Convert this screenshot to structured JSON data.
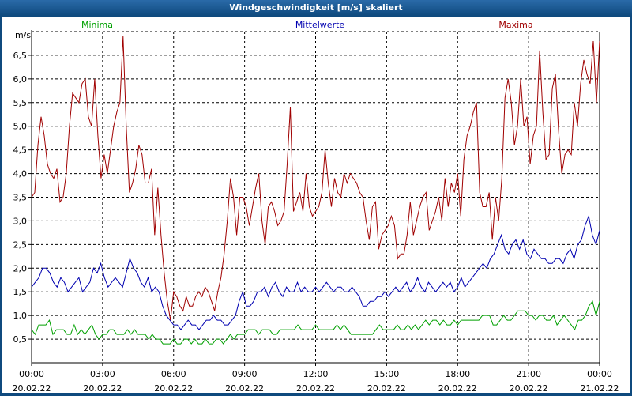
{
  "window": {
    "title": "Windgeschwindigkeit [m/s] skaliert"
  },
  "colors": {
    "minima": "#00a000",
    "mittel": "#0000b0",
    "maxima": "#a00000",
    "titlebar": "#0f4a7e"
  },
  "chart_data": {
    "type": "line",
    "title": "Windgeschwindigkeit [m/s] skaliert",
    "ylabel": "m/s",
    "xlabel": "",
    "ylim": [
      0,
      7.0
    ],
    "xlim": [
      0,
      144
    ],
    "grid": true,
    "legend_position": "top",
    "y_ticks": [
      "0,5",
      "1,0",
      "1,5",
      "2,0",
      "2,5",
      "3,0",
      "3,5",
      "4,0",
      "4,5",
      "5,0",
      "5,5",
      "6,0",
      "6,5"
    ],
    "x_ticks": [
      {
        "time": "00:00",
        "date": "20.02.22"
      },
      {
        "time": "03:00",
        "date": "20.02.22"
      },
      {
        "time": "06:00",
        "date": "20.02.22"
      },
      {
        "time": "09:00",
        "date": "20.02.22"
      },
      {
        "time": "12:00",
        "date": "20.02.22"
      },
      {
        "time": "15:00",
        "date": "20.02.22"
      },
      {
        "time": "18:00",
        "date": "20.02.22"
      },
      {
        "time": "21:00",
        "date": "20.02.22"
      },
      {
        "time": "00:00",
        "date": "21.02.22"
      }
    ],
    "x_unit_minutes": 10,
    "series": [
      {
        "name": "Minima",
        "values": [
          0.7,
          0.6,
          0.8,
          0.8,
          0.8,
          0.9,
          0.6,
          0.7,
          0.7,
          0.7,
          0.6,
          0.6,
          0.8,
          0.6,
          0.7,
          0.6,
          0.7,
          0.8,
          0.6,
          0.5,
          0.6,
          0.6,
          0.7,
          0.7,
          0.6,
          0.6,
          0.6,
          0.7,
          0.6,
          0.7,
          0.6,
          0.6,
          0.6,
          0.5,
          0.6,
          0.5,
          0.5,
          0.4,
          0.4,
          0.4,
          0.5,
          0.4,
          0.4,
          0.5,
          0.5,
          0.4,
          0.5,
          0.4,
          0.4,
          0.5,
          0.4,
          0.4,
          0.5,
          0.5,
          0.4,
          0.5,
          0.6,
          0.5,
          0.6,
          0.6,
          0.6,
          0.7,
          0.7,
          0.7,
          0.6,
          0.7,
          0.7,
          0.7,
          0.6,
          0.6,
          0.7,
          0.7,
          0.7,
          0.7,
          0.7,
          0.8,
          0.7,
          0.7,
          0.7,
          0.7,
          0.8,
          0.7,
          0.7,
          0.7,
          0.7,
          0.7,
          0.8,
          0.7,
          0.8,
          0.7,
          0.6,
          0.6,
          0.6,
          0.6,
          0.6,
          0.6,
          0.6,
          0.7,
          0.8,
          0.7,
          0.7,
          0.7,
          0.7,
          0.8,
          0.7,
          0.7,
          0.8,
          0.7,
          0.8,
          0.7,
          0.8,
          0.9,
          0.8,
          0.9,
          0.9,
          0.8,
          0.9,
          0.8,
          0.8,
          0.9,
          0.8,
          0.9,
          0.9,
          0.9,
          0.9,
          0.9,
          0.9,
          1.0,
          1.0,
          1.0,
          0.8,
          0.8,
          0.9,
          1.0,
          0.9,
          0.9,
          1.0,
          1.1,
          1.1,
          1.1,
          1.0,
          1.0,
          0.9,
          1.0,
          1.0,
          0.9,
          0.9,
          1.0,
          0.8,
          0.9,
          1.0,
          0.9,
          0.8,
          0.7,
          0.9,
          0.9,
          1.0,
          1.2,
          1.3,
          1.0,
          1.3
        ]
      },
      {
        "name": "Mittelwerte",
        "values": [
          1.6,
          1.7,
          1.8,
          2.0,
          2.0,
          1.9,
          1.7,
          1.6,
          1.8,
          1.7,
          1.5,
          1.6,
          1.7,
          1.8,
          1.5,
          1.6,
          1.7,
          2.0,
          1.9,
          2.1,
          1.8,
          1.6,
          1.7,
          1.8,
          1.7,
          1.6,
          1.9,
          2.2,
          2.0,
          1.9,
          1.7,
          1.6,
          1.8,
          1.5,
          1.6,
          1.5,
          1.2,
          1.0,
          0.9,
          0.8,
          0.8,
          0.7,
          0.8,
          0.9,
          0.8,
          0.8,
          0.7,
          0.8,
          0.9,
          0.9,
          1.0,
          0.9,
          0.9,
          0.8,
          0.8,
          0.9,
          1.0,
          1.3,
          1.5,
          1.2,
          1.2,
          1.3,
          1.5,
          1.5,
          1.6,
          1.4,
          1.6,
          1.7,
          1.5,
          1.4,
          1.6,
          1.5,
          1.5,
          1.7,
          1.5,
          1.6,
          1.5,
          1.5,
          1.6,
          1.5,
          1.6,
          1.7,
          1.6,
          1.5,
          1.6,
          1.6,
          1.5,
          1.5,
          1.6,
          1.5,
          1.4,
          1.2,
          1.2,
          1.3,
          1.3,
          1.4,
          1.4,
          1.5,
          1.4,
          1.5,
          1.6,
          1.5,
          1.6,
          1.7,
          1.5,
          1.6,
          1.8,
          1.6,
          1.5,
          1.7,
          1.6,
          1.5,
          1.6,
          1.7,
          1.6,
          1.7,
          1.5,
          1.6,
          1.8,
          1.6,
          1.7,
          1.8,
          1.9,
          2.0,
          2.1,
          2.0,
          2.2,
          2.3,
          2.5,
          2.7,
          2.4,
          2.3,
          2.5,
          2.6,
          2.4,
          2.6,
          2.3,
          2.2,
          2.4,
          2.3,
          2.2,
          2.2,
          2.1,
          2.1,
          2.2,
          2.2,
          2.1,
          2.3,
          2.4,
          2.2,
          2.5,
          2.6,
          2.9,
          3.1,
          2.7,
          2.5,
          2.8
        ]
      },
      {
        "name": "Maxima",
        "values": [
          3.5,
          3.6,
          4.6,
          5.2,
          4.8,
          4.2,
          4.0,
          3.9,
          4.1,
          3.4,
          3.5,
          4.0,
          5.0,
          5.7,
          5.6,
          5.5,
          5.9,
          6.0,
          5.2,
          5.0,
          6.0,
          4.8,
          3.9,
          4.4,
          4.0,
          4.5,
          5.0,
          5.3,
          5.5,
          6.9,
          5.0,
          3.6,
          3.8,
          4.1,
          4.6,
          4.4,
          3.8,
          3.8,
          4.1,
          2.7,
          3.7,
          2.7,
          1.9,
          1.3,
          0.9,
          1.5,
          1.4,
          1.2,
          1.1,
          1.4,
          1.2,
          1.2,
          1.4,
          1.5,
          1.4,
          1.6,
          1.5,
          1.3,
          1.1,
          1.5,
          1.8,
          2.3,
          3.0,
          3.9,
          3.5,
          2.7,
          3.5,
          3.5,
          3.3,
          2.9,
          3.3,
          3.7,
          4.0,
          3.0,
          2.5,
          3.3,
          3.4,
          3.2,
          2.9,
          3.0,
          3.2,
          4.2,
          5.4,
          3.2,
          3.4,
          3.6,
          3.2,
          4.0,
          3.3,
          3.1,
          3.2,
          3.3,
          3.6,
          4.5,
          3.8,
          3.3,
          3.9,
          3.6,
          3.5,
          4.0,
          3.8,
          4.0,
          3.9,
          3.8,
          3.6,
          3.5,
          3.0,
          2.6,
          3.3,
          3.4,
          2.4,
          2.7,
          2.8,
          2.9,
          3.1,
          2.9,
          2.2,
          2.3,
          2.3,
          2.7,
          3.4,
          2.7,
          3.0,
          3.3,
          3.5,
          3.6,
          2.8,
          3.0,
          3.2,
          3.5,
          3.0,
          3.9,
          3.3,
          3.8,
          3.6,
          4.0,
          3.1,
          4.3,
          4.8,
          5.0,
          5.3,
          5.5,
          3.6,
          3.3,
          3.3,
          3.6,
          2.6,
          3.5,
          3.0,
          3.9,
          5.6,
          6.0,
          5.5,
          4.6,
          5.0,
          6.0,
          5.0,
          5.2,
          4.2,
          4.8,
          5.0,
          6.6,
          5.3,
          4.3,
          4.4,
          5.8,
          6.1,
          4.9,
          4.0,
          4.4,
          4.5,
          4.4,
          5.5,
          5.0,
          5.9,
          6.4,
          6.1,
          5.9,
          6.8,
          5.5,
          6.8
        ]
      }
    ]
  }
}
